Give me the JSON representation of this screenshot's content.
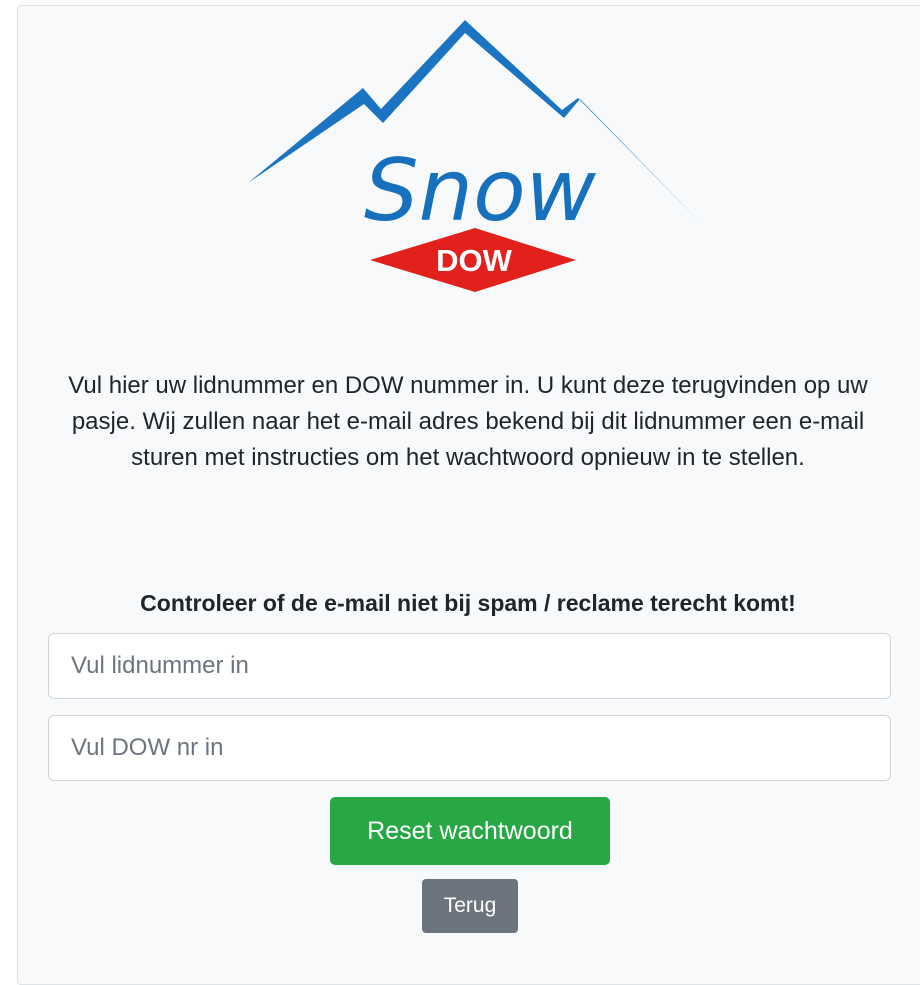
{
  "logo": {
    "word": "Snow",
    "badge": "DOW",
    "colors": {
      "mountain": "#1a74c1",
      "word": "#1670bb",
      "badge": "#e2201c"
    }
  },
  "intro_text": "Vul hier uw lidnummer en DOW nummer in. U kunt deze terugvinden op uw pasje. Wij zullen naar het e-mail adres bekend bij dit lidnummer een e-mail sturen met instructies om het wachtwoord opnieuw in te stellen.",
  "warning_text": "Controleer of de e-mail niet bij spam / reclame terecht komt!",
  "form": {
    "lidnummer": {
      "placeholder": "Vul lidnummer in",
      "value": ""
    },
    "dow_nr": {
      "placeholder": "Vul DOW nr in",
      "value": ""
    },
    "reset_label": "Reset wachtwoord",
    "back_label": "Terug"
  },
  "colors": {
    "reset_button": "#28a745",
    "back_button": "#6c757d",
    "card_background": "#f8f9fa"
  }
}
